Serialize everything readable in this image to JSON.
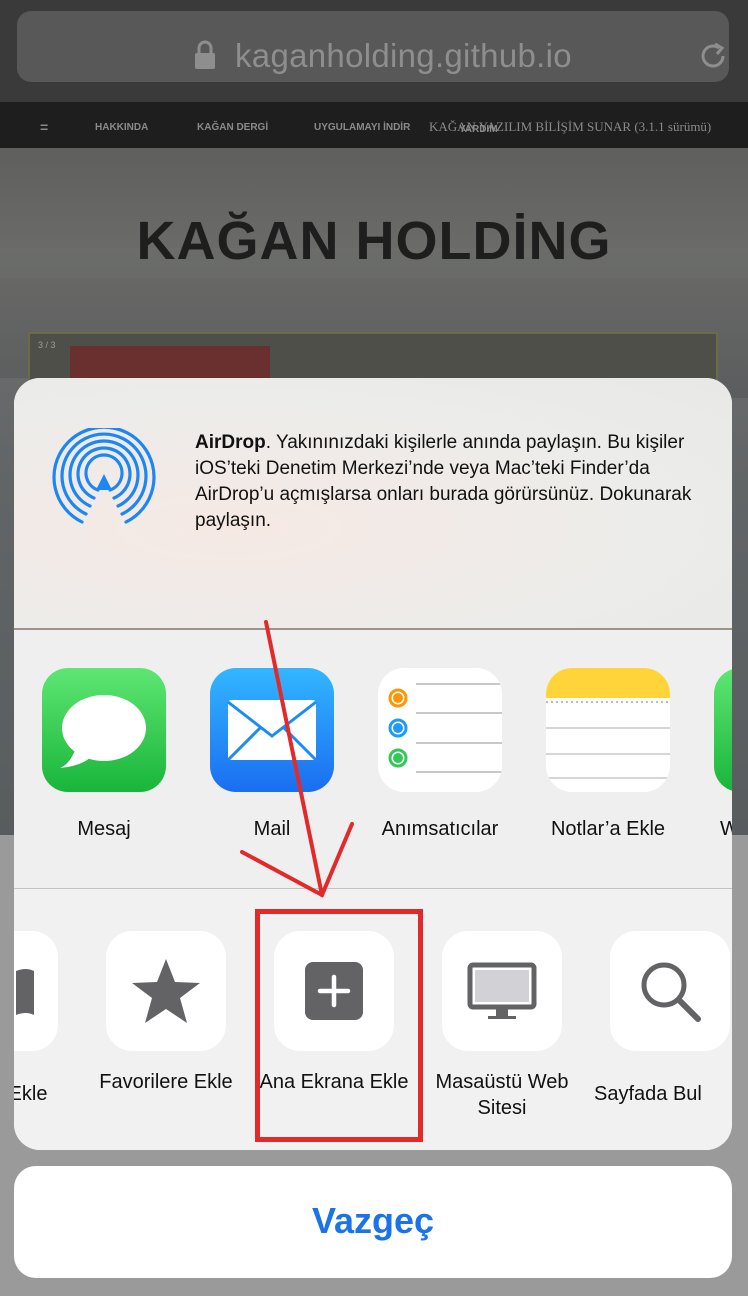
{
  "browser": {
    "url": "kaganholding.github.io",
    "icons": {
      "lock": "lock-icon",
      "reload": "reload-icon"
    }
  },
  "website": {
    "nav": {
      "menu": "=",
      "items": [
        "HAKKINDA",
        "KAĞAN DERGİ",
        "UYGULAMAYI İNDİR",
        "YARDIM"
      ],
      "version": "KAĞAN YAZILIM BİLİŞİM SUNAR (3.1.1 sürümü)"
    },
    "title": "KAĞAN HOLDİNG",
    "slide_counter": "3 / 3"
  },
  "share_sheet": {
    "airdrop": {
      "title": "AirDrop",
      "description": ". Yakınınızdaki kişilerle anında paylaşın. Bu kişiler iOS’teki Denetim Merkezi’nde veya Mac’teki Finder’da AirDrop’u açmışlarsa onları burada görürsünüz. Dokunarak paylaşın.",
      "icon": "airdrop-icon"
    },
    "apps": [
      {
        "label": "Mesaj",
        "icon": "messages-icon",
        "color": "#34c759"
      },
      {
        "label": "Mail",
        "icon": "mail-icon",
        "color": "#1a8cf7"
      },
      {
        "label": "Anımsatıcılar",
        "icon": "reminders-icon",
        "color": "#ffffff"
      },
      {
        "label": "Notlar’a Ekle",
        "icon": "notes-icon",
        "color": "#ffd43b"
      },
      {
        "label": "W",
        "icon": "whatsapp-icon",
        "color": "#34c759"
      }
    ],
    "actions": [
      {
        "label": "Ekle",
        "icon": "bookmark-icon"
      },
      {
        "label": "Favorilere Ekle",
        "icon": "star-icon"
      },
      {
        "label": "Ana Ekrana Ekle",
        "icon": "add-to-home-icon"
      },
      {
        "label": "Masaüstü Web Sitesi",
        "icon": "desktop-icon"
      },
      {
        "label": "Sayfada Bul",
        "icon": "search-icon"
      }
    ],
    "cancel": "Vazgeç"
  },
  "colors": {
    "accent": "#1a73e8",
    "highlight": "#e32a2a"
  }
}
